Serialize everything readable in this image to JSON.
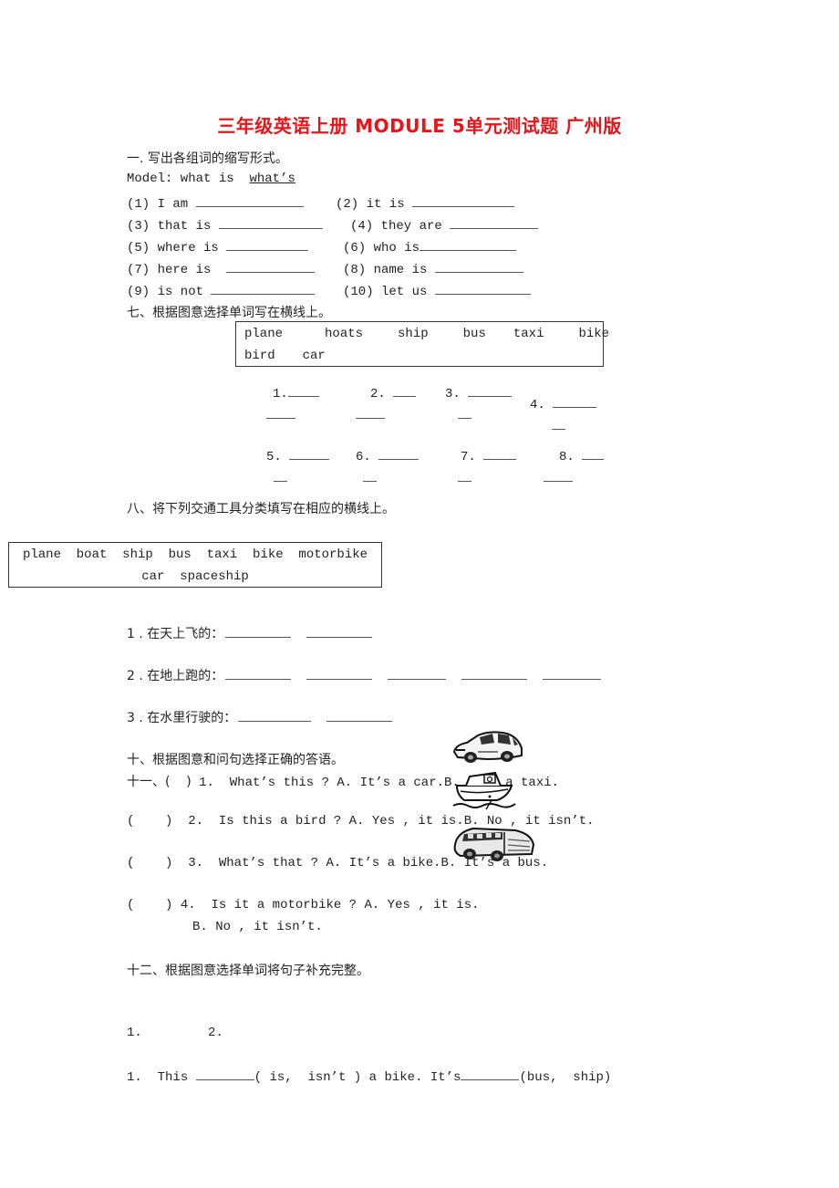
{
  "title": "三年级英语上册 MODULE 5单元测试题 广州版",
  "section1": {
    "heading": "一. 写出各组词的缩写形式。",
    "model_prefix": "Model: what is ",
    "model_answer": "what’s",
    "items": [
      {
        "label": "(1) I am"
      },
      {
        "label": "(2) it is"
      },
      {
        "label": "(3) that is"
      },
      {
        "label": "(4) they are"
      },
      {
        "label": "(5) where is"
      },
      {
        "label": "(6) who is"
      },
      {
        "label": "(7) here is"
      },
      {
        "label": "(8) name is"
      },
      {
        "label": "(9) is not"
      },
      {
        "label": "(10) let us"
      }
    ]
  },
  "section7": {
    "heading": "七、根据图意选择单词写在横线上。",
    "words_line1": [
      "plane",
      "hoats",
      "ship",
      "bus",
      "taxi",
      "bike"
    ],
    "words_line2": [
      "bird",
      "car"
    ],
    "blanks": [
      "1.",
      "2.",
      "3.",
      "4.",
      "5.",
      "6.",
      "7.",
      "8."
    ]
  },
  "section8": {
    "heading": "八、将下列交通工具分类填写在相应的横线上。",
    "words_line1": "plane  boat  ship  bus  taxi  bike  motorbike",
    "words_line2": "car  spaceship",
    "items": [
      {
        "label": "1 . 在天上飞的：",
        "blanks": 2
      },
      {
        "label": "2 . 在地上跑的：",
        "blanks": 5
      },
      {
        "label": "3 . 在水里行驶的：",
        "blanks": 2
      }
    ]
  },
  "section10": {
    "heading": "十、根据图意和问句选择正确的答语。",
    "q1_prefix": "十一、(    )",
    "questions": [
      {
        "num": "1.",
        "text": "What’s this ? A. It’s a car.B. It’s a taxi."
      },
      {
        "num": "2.",
        "text": "Is this a bird ? A. Yes , it is.B. No , it isn’t."
      },
      {
        "num": "3.",
        "text": "What’s that ? A. It’s a bike.B. It’s a bus."
      },
      {
        "num": "4.",
        "text": "Is it a motorbike ? A. Yes , it is.",
        "text2": "B. No , it isn’t."
      }
    ],
    "paren": "(    )",
    "pictures": [
      "car-picture",
      "boat-picture",
      "bus-picture"
    ]
  },
  "section12": {
    "heading": "十二、根据图意选择单词将句子补充完整。",
    "pic_labels": [
      "1.",
      "2."
    ],
    "sentence_num": "1.",
    "sentence_part1": "This ",
    "sentence_part2": "( is,  isn’t ) a bike. It’s",
    "sentence_part3": "(bus,  ship)"
  }
}
